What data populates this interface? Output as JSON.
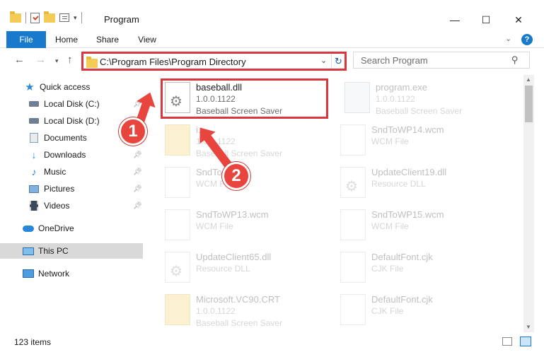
{
  "window": {
    "title": "Program",
    "minimize": "—",
    "maximize": "☐",
    "close": "✕"
  },
  "ribbon": {
    "tabs": [
      "File",
      "Home",
      "Share",
      "View"
    ],
    "help": "?"
  },
  "nav": {
    "address": "C:\\Program Files\\Program Directory",
    "search_placeholder": "Search Program"
  },
  "sidebar": {
    "items": [
      {
        "label": "Quick access",
        "icon": "star-icon"
      },
      {
        "label": "Local Disk (C:)",
        "icon": "drive-icon",
        "pinned": true
      },
      {
        "label": "Local Disk (D:)",
        "icon": "drive-icon"
      },
      {
        "label": "Documents",
        "icon": "documents-icon"
      },
      {
        "label": "Downloads",
        "icon": "downloads-icon",
        "pinned": true
      },
      {
        "label": "Music",
        "icon": "music-icon",
        "pinned": true
      },
      {
        "label": "Pictures",
        "icon": "pictures-icon",
        "pinned": true
      },
      {
        "label": "Videos",
        "icon": "videos-icon",
        "pinned": true
      },
      {
        "label": "OneDrive",
        "icon": "onedrive-icon"
      },
      {
        "label": "This PC",
        "icon": "this-pc-icon",
        "selected": true
      },
      {
        "label": "Network",
        "icon": "network-icon"
      }
    ]
  },
  "files": [
    {
      "name": "baseball.dll",
      "line2": "1.0.0.1122",
      "line3": "Baseball Screen Saver",
      "type": "dll",
      "highlighted": true
    },
    {
      "name": "program.exe",
      "line2": "1.0.0.1122",
      "line3": "Baseball Screen Saver",
      "type": "exe"
    },
    {
      "name": "i...",
      "line2": "1.0.0.1122",
      "line3": "Baseball Screen Saver",
      "type": "folder"
    },
    {
      "name": "SndToWP14.wcm",
      "line2": "WCM File",
      "line3": "",
      "type": "doc"
    },
    {
      "name": "SndTo...wcm",
      "line2": "WCM File",
      "line3": "",
      "type": "doc"
    },
    {
      "name": "UpdateClient19.dll",
      "line2": "Resource DLL",
      "line3": "",
      "type": "dll"
    },
    {
      "name": "SndToWP13.wcm",
      "line2": "WCM File",
      "line3": "",
      "type": "doc"
    },
    {
      "name": "SndToWP15.wcm",
      "line2": "WCM File",
      "line3": "",
      "type": "doc"
    },
    {
      "name": "UpdateClient65.dll",
      "line2": "Resource DLL",
      "line3": "",
      "type": "dll"
    },
    {
      "name": "DefaultFont.cjk",
      "line2": "CJK File",
      "line3": "",
      "type": "doc"
    },
    {
      "name": "Microsoft.VC90.CRT",
      "line2": "1.0.0.1122",
      "line3": "Baseball Screen Saver",
      "type": "folder"
    },
    {
      "name": "DefaultFont.cjk",
      "line2": "CJK File",
      "line3": "",
      "type": "doc"
    }
  ],
  "status": {
    "item_count": "123 items"
  },
  "annotations": [
    {
      "label": "1"
    },
    {
      "label": "2"
    }
  ],
  "colors": {
    "accent": "#1979ca",
    "annotation": "#e8453f",
    "highlight_border": "#d9363e"
  }
}
